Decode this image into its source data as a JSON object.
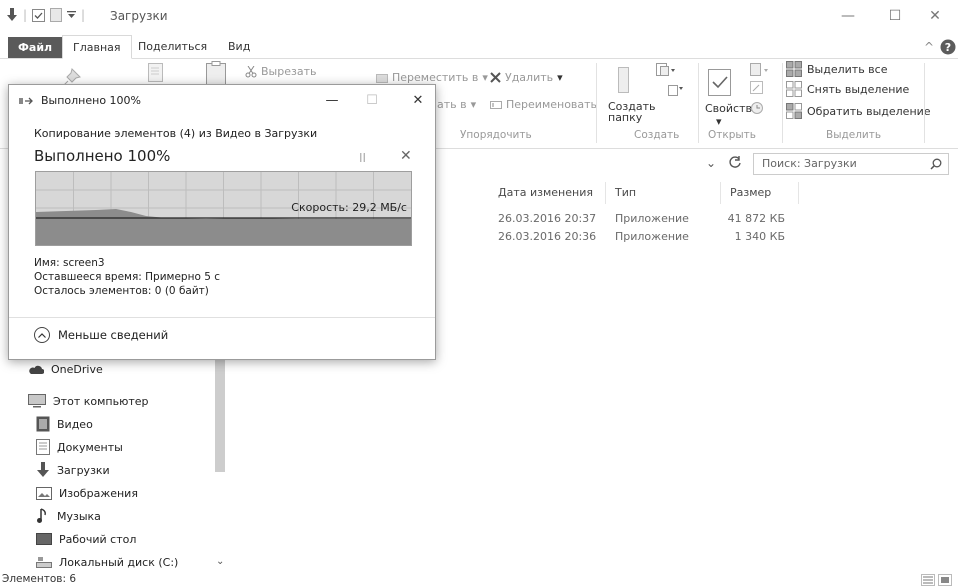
{
  "window": {
    "title": "Загрузки",
    "minimize": "—",
    "maximize": "☐",
    "close": "✕"
  },
  "tabs": [
    "Файл",
    "Главная",
    "Поделиться",
    "Вид"
  ],
  "ribbon": {
    "cut": "Вырезать",
    "move_to": "Переместить в",
    "copy_to": "ать в",
    "delete": "Удалить",
    "rename": "Переименовать",
    "new_folder_1": "Создать",
    "new_folder_2": "папку",
    "properties": "Свойства",
    "select_all": "Выделить все",
    "select_none": "Снять выделение",
    "invert_selection": "Обратить выделение",
    "groups": {
      "organize": "Упорядочить",
      "create": "Создать",
      "open": "Открыть",
      "select": "Выделить"
    }
  },
  "search": {
    "placeholder": "Поиск: Загрузки"
  },
  "columns": {
    "date": "Дата изменения",
    "type": "Тип",
    "size": "Размер"
  },
  "files": [
    {
      "date": "26.03.2016 20:37",
      "type": "Приложение",
      "size": "41 872 КБ"
    },
    {
      "date": "26.03.2016 20:36",
      "type": "Приложение",
      "size": "1 340 КБ"
    }
  ],
  "nav": {
    "onedrive": "OneDrive",
    "this_pc": "Этот компьютер",
    "items": [
      "Видео",
      "Документы",
      "Загрузки",
      "Изображения",
      "Музыка",
      "Рабочий стол",
      "Локальный диск (C:)"
    ]
  },
  "status": {
    "elements": "Элементов: 6"
  },
  "dialog": {
    "title": "Выполнено 100%",
    "copy_description": "Копирование элементов (4) из Видео в Загрузки",
    "big_status": "Выполнено 100%",
    "pause": "II",
    "cancel": "✕",
    "speed": "Скорость: 29,2 МБ/с",
    "name": "Имя: screen3",
    "time_left": "Оставшееся время: Примерно 5 с",
    "items_left": "Осталось элементов: 0 (0 байт)",
    "less_details": "Меньше сведений",
    "progress_percent": 100
  },
  "colors": {
    "file_tab": "#5a5a5a",
    "graph_bg": "#d7d7d7",
    "graph_fill": "#8c8c8c"
  }
}
